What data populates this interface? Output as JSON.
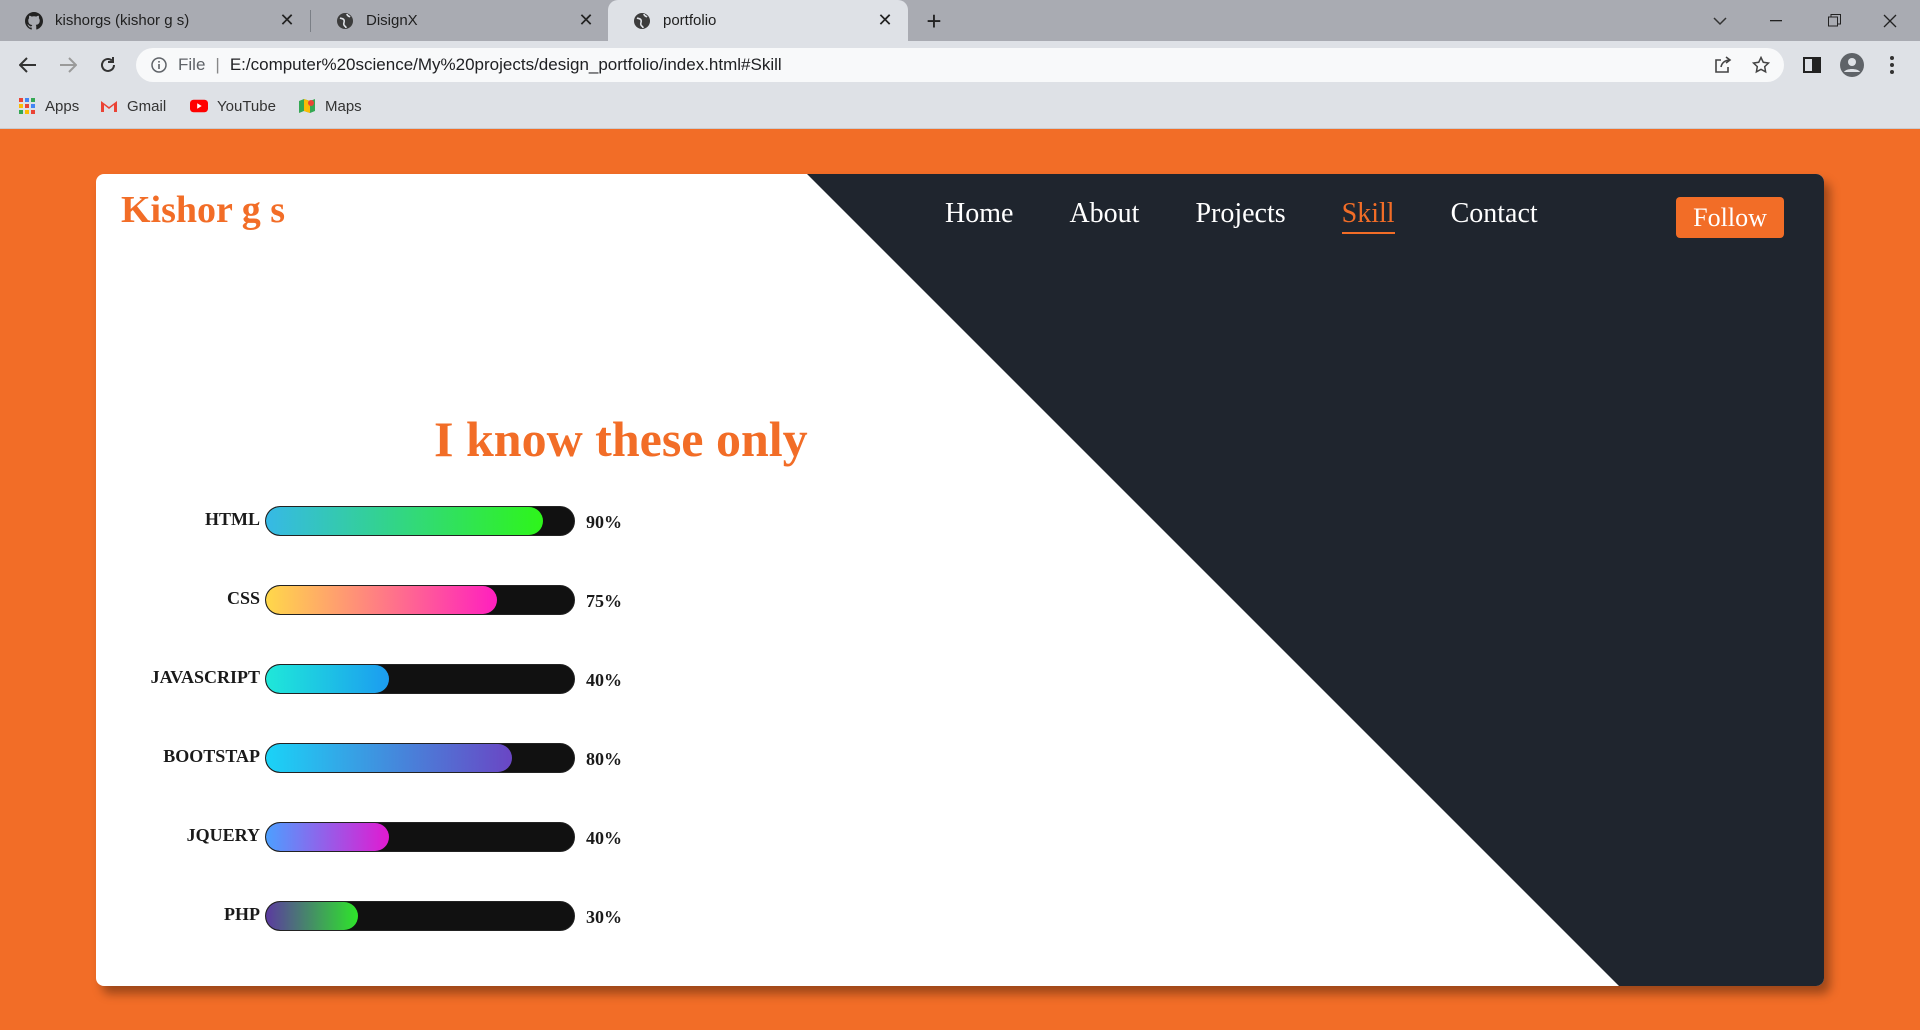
{
  "browser": {
    "tabs": [
      {
        "title": "kishorgs (kishor g s)",
        "icon": "github-icon",
        "active": false
      },
      {
        "title": "DisignX",
        "icon": "globe-icon",
        "active": false
      },
      {
        "title": "portfolio",
        "icon": "globe-icon",
        "active": true
      }
    ],
    "address": {
      "file_label": "File",
      "url": "E:/computer%20science/My%20projects/design_portfolio/index.html#Skill"
    },
    "bookmarks": [
      {
        "label": "Apps",
        "icon": "apps-grid-icon"
      },
      {
        "label": "Gmail",
        "icon": "gmail-icon"
      },
      {
        "label": "YouTube",
        "icon": "youtube-icon"
      },
      {
        "label": "Maps",
        "icon": "maps-icon"
      }
    ]
  },
  "site": {
    "logo": "Kishor g s",
    "nav": [
      "Home",
      "About",
      "Projects",
      "Skill",
      "Contact"
    ],
    "active_nav": "Skill",
    "follow_label": "Follow",
    "heading": "I know these only",
    "skills": [
      {
        "name": "HTML",
        "percent_label": "90%",
        "level": 0.9,
        "gradient": [
          "#36b9e6",
          "#2ef51a"
        ]
      },
      {
        "name": "CSS",
        "percent_label": "75%",
        "level": 0.75,
        "gradient": [
          "#ffd84a",
          "#ff1fbf"
        ]
      },
      {
        "name": "JAVASCRIPT",
        "percent_label": "40%",
        "level": 0.4,
        "gradient": [
          "#1fe8d9",
          "#1c9cf0"
        ]
      },
      {
        "name": "BOOTSTAP",
        "percent_label": "80%",
        "level": 0.8,
        "gradient": [
          "#1ad3f7",
          "#6a46c4"
        ]
      },
      {
        "name": "JQUERY",
        "percent_label": "40%",
        "level": 0.4,
        "gradient": [
          "#4d9fff",
          "#e11ad1"
        ]
      },
      {
        "name": "PHP",
        "percent_label": "30%",
        "level": 0.3,
        "gradient": [
          "#5b3aa0",
          "#2ee52a"
        ]
      }
    ]
  },
  "colors": {
    "accent": "#f26d27",
    "dark_panel": "#1f252e",
    "bar_track": "#111111"
  }
}
